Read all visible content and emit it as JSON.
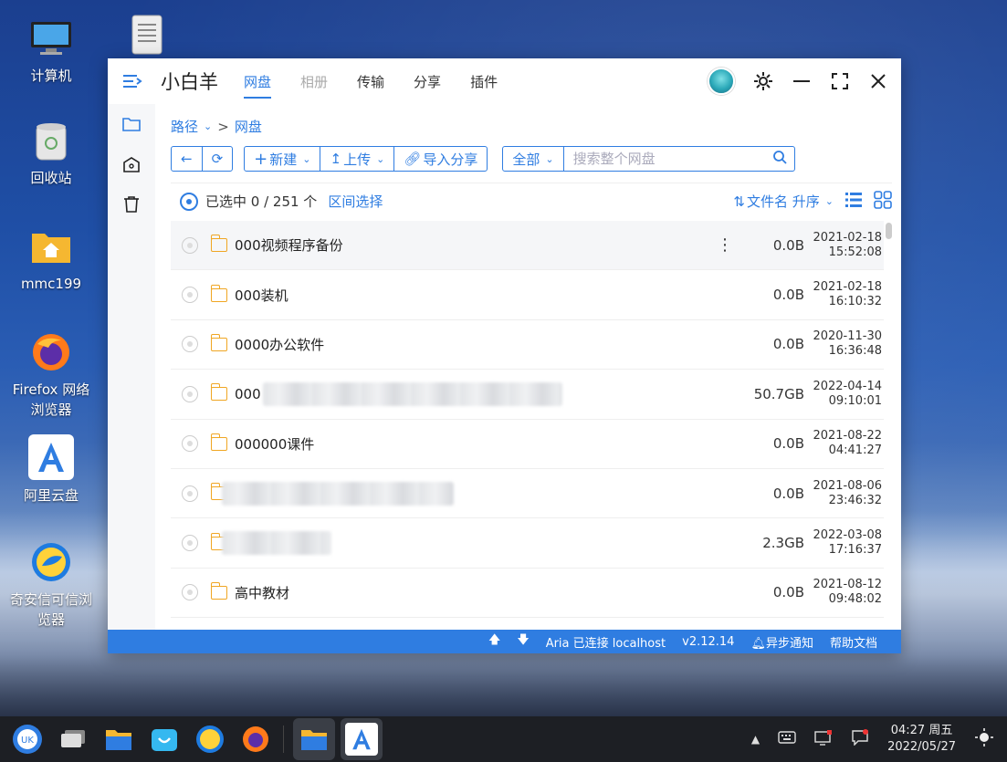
{
  "desktop": {
    "icons": [
      {
        "label": "计算机"
      },
      {
        "label": "回收站"
      },
      {
        "label": "mmc199"
      },
      {
        "label": "Firefox 网络\n浏览器",
        "line1": "Firefox 网络",
        "line2": "浏览器"
      },
      {
        "label": "阿里云盘"
      },
      {
        "label": "奇安信可信浏览器",
        "line1": "奇安信可信浏",
        "line2": "览器"
      }
    ]
  },
  "app": {
    "title": "小白羊",
    "tabs": [
      {
        "label": "网盘",
        "active": true
      },
      {
        "label": "相册",
        "disabled": true
      },
      {
        "label": "传输"
      },
      {
        "label": "分享"
      },
      {
        "label": "插件"
      }
    ],
    "breadcrumb": {
      "root": "路径",
      "sep": ">",
      "current": "网盘"
    },
    "toolbar": {
      "new_label": "新建",
      "upload_label": "上传",
      "import_label": "导入分享",
      "filter_label": "全部",
      "search_placeholder": "搜索整个网盘"
    },
    "selection": {
      "text": "已选中 0 / 251 个",
      "range_label": "区间选择",
      "sort_label": "文件名 升序"
    },
    "files": [
      {
        "name": "000视频程序备份",
        "size": "0.0B",
        "date": "2021-02-18",
        "time": "15:52:08",
        "blurred": false
      },
      {
        "name": "000装机",
        "size": "0.0B",
        "date": "2021-02-18",
        "time": "16:10:32",
        "blurred": false
      },
      {
        "name": "0000办公软件",
        "size": "0.0B",
        "date": "2020-11-30",
        "time": "16:36:48",
        "blurred": false
      },
      {
        "name": "000",
        "size": "50.7GB",
        "date": "2022-04-14",
        "time": "09:10:01",
        "blurred": true
      },
      {
        "name": "000000课件",
        "size": "0.0B",
        "date": "2021-08-22",
        "time": "04:41:27",
        "blurred": false
      },
      {
        "name": "",
        "size": "0.0B",
        "date": "2021-08-06",
        "time": "23:46:32",
        "blurred": true
      },
      {
        "name": "",
        "size": "2.3GB",
        "date": "2022-03-08",
        "time": "17:16:37",
        "blurred": true
      },
      {
        "name": "高中教材",
        "size": "0.0B",
        "date": "2021-08-12",
        "time": "09:48:02",
        "blurred": false
      }
    ],
    "status": {
      "aria": "Aria 已连接 localhost",
      "version": "v2.12.14",
      "notify": "异步通知",
      "help": "帮助文档"
    }
  },
  "taskbar": {
    "clock_time": "04:27 周五",
    "clock_date": "2022/05/27"
  },
  "colors": {
    "accent": "#2f7de1",
    "folder": "#f0a623"
  }
}
